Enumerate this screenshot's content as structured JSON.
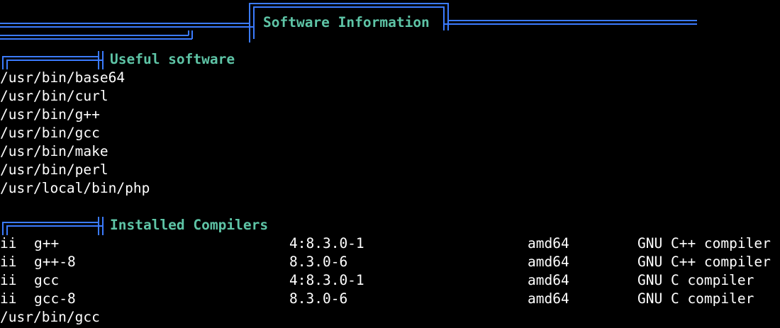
{
  "title": "Software Information",
  "sections": {
    "useful_software": {
      "heading": "Useful software",
      "items": [
        "/usr/bin/base64",
        "/usr/bin/curl",
        "/usr/bin/g++",
        "/usr/bin/gcc",
        "/usr/bin/make",
        "/usr/bin/perl",
        "/usr/local/bin/php"
      ]
    },
    "installed_compilers": {
      "heading": "Installed Compilers",
      "packages": [
        {
          "status": "ii",
          "name": "g++",
          "version": "4:8.3.0-1",
          "arch": "amd64",
          "description": "GNU C++ compiler"
        },
        {
          "status": "ii",
          "name": "g++-8",
          "version": "8.3.0-6",
          "arch": "amd64",
          "description": "GNU C++ compiler"
        },
        {
          "status": "ii",
          "name": "gcc",
          "version": "4:8.3.0-1",
          "arch": "amd64",
          "description": "GNU C compiler"
        },
        {
          "status": "ii",
          "name": "gcc-8",
          "version": "8.3.0-6",
          "arch": "amd64",
          "description": "GNU C compiler"
        }
      ],
      "trailing": "/usr/bin/gcc"
    }
  },
  "colors": {
    "background": "#000000",
    "text": "#ffffff",
    "heading": "#5ec4a6",
    "frame": "#3b7bff"
  }
}
